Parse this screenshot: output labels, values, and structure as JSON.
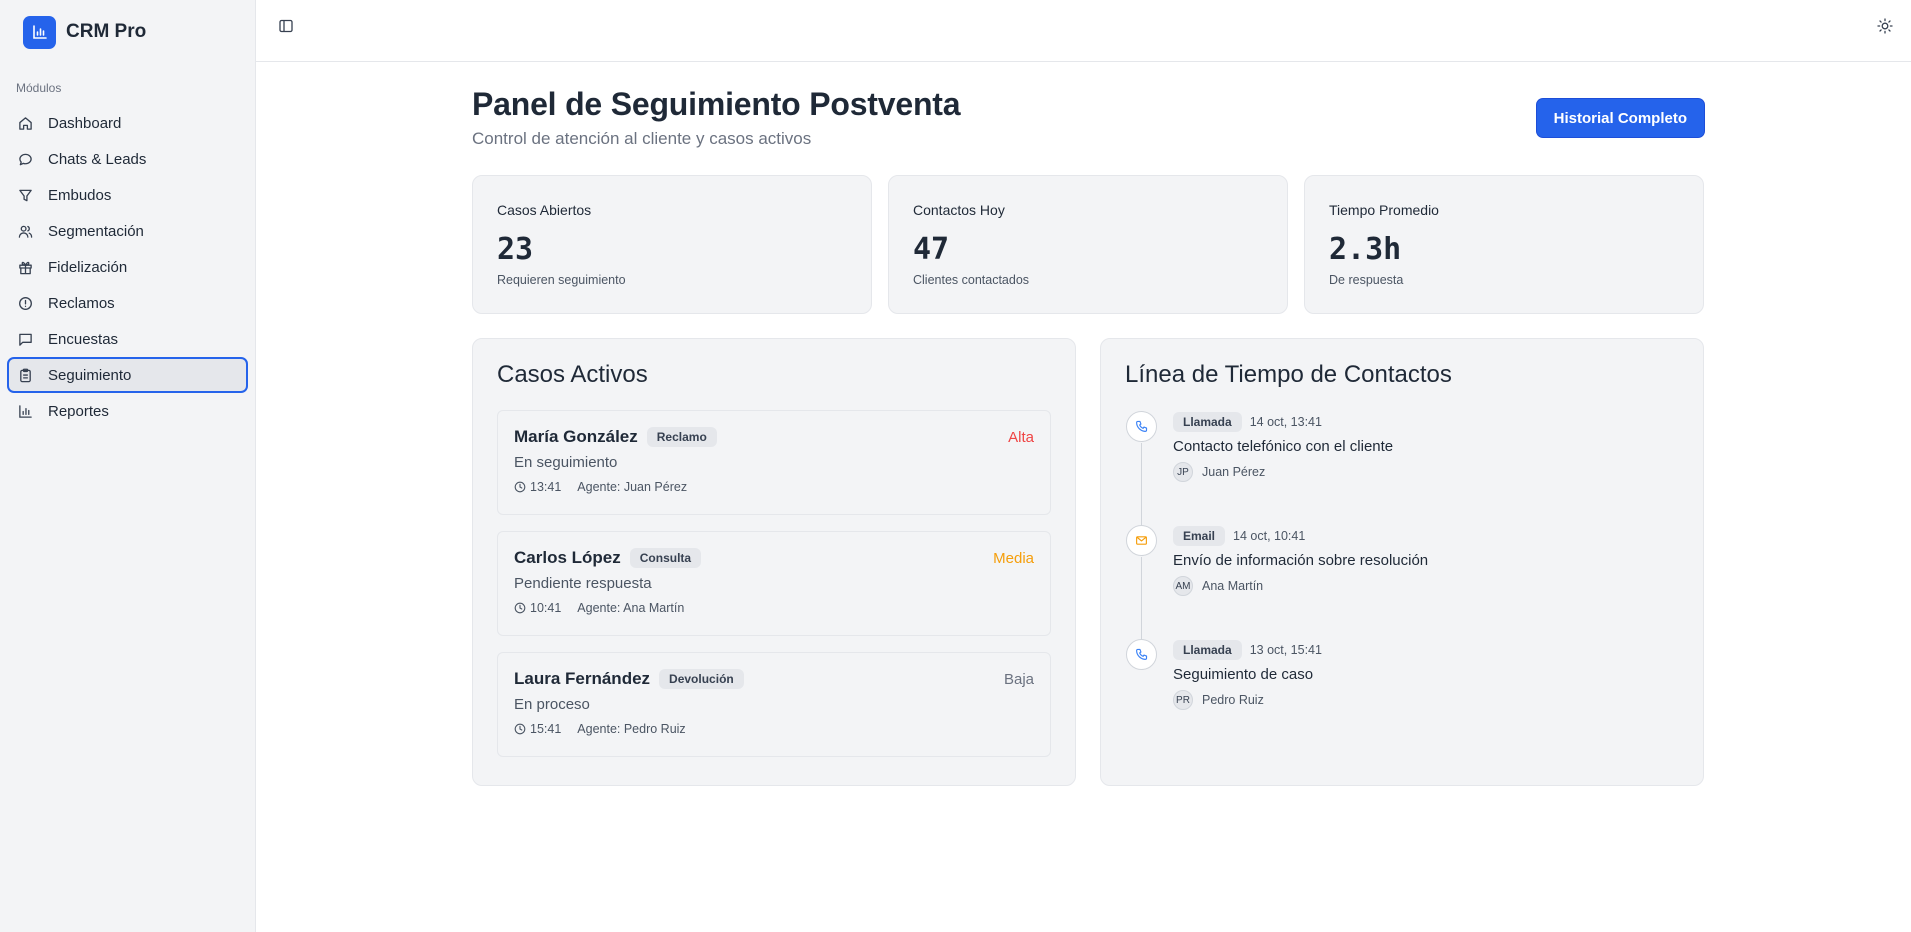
{
  "app": {
    "name": "CRM Pro"
  },
  "sidebar": {
    "section_label": "Módulos",
    "items": [
      {
        "label": "Dashboard",
        "icon": "home-icon"
      },
      {
        "label": "Chats & Leads",
        "icon": "chat-icon"
      },
      {
        "label": "Embudos",
        "icon": "funnel-icon"
      },
      {
        "label": "Segmentación",
        "icon": "users-icon"
      },
      {
        "label": "Fidelización",
        "icon": "gift-icon"
      },
      {
        "label": "Reclamos",
        "icon": "alert-circle-icon"
      },
      {
        "label": "Encuestas",
        "icon": "message-square-icon"
      },
      {
        "label": "Seguimiento",
        "icon": "clipboard-icon",
        "active": true
      },
      {
        "label": "Reportes",
        "icon": "bar-chart-icon"
      }
    ]
  },
  "header": {
    "title": "Panel de Seguimiento Postventa",
    "subtitle": "Control de atención al cliente y casos activos",
    "history_button": "Historial Completo"
  },
  "stats": [
    {
      "title": "Casos Abiertos",
      "value": "23",
      "sub": "Requieren seguimiento"
    },
    {
      "title": "Contactos Hoy",
      "value": "47",
      "sub": "Clientes contactados"
    },
    {
      "title": "Tiempo Promedio",
      "value": "2.3h",
      "sub": "De respuesta"
    }
  ],
  "cases": {
    "title": "Casos Activos",
    "items": [
      {
        "name": "María González",
        "type": "Reclamo",
        "priority": "Alta",
        "priority_color": "#ef4444",
        "status": "En seguimiento",
        "time": "13:41",
        "agent": "Agente: Juan Pérez"
      },
      {
        "name": "Carlos López",
        "type": "Consulta",
        "priority": "Media",
        "priority_color": "#f59e0b",
        "status": "Pendiente respuesta",
        "time": "10:41",
        "agent": "Agente: Ana Martín"
      },
      {
        "name": "Laura Fernández",
        "type": "Devolución",
        "priority": "Baja",
        "priority_color": "#6b7280",
        "status": "En proceso",
        "time": "15:41",
        "agent": "Agente: Pedro Ruiz"
      }
    ]
  },
  "timeline": {
    "title": "Línea de Tiempo de Contactos",
    "items": [
      {
        "type": "Llamada",
        "icon": "phone-icon",
        "icon_color": "#3b82f6",
        "time": "14 oct, 13:41",
        "description": "Contacto telefónico con el cliente",
        "initials": "JP",
        "agent": "Juan Pérez"
      },
      {
        "type": "Email",
        "icon": "mail-icon",
        "icon_color": "#f59e0b",
        "time": "14 oct, 10:41",
        "description": "Envío de información sobre resolución",
        "initials": "AM",
        "agent": "Ana Martín"
      },
      {
        "type": "Llamada",
        "icon": "phone-icon",
        "icon_color": "#3b82f6",
        "time": "13 oct, 15:41",
        "description": "Seguimiento de caso",
        "initials": "PR",
        "agent": "Pedro Ruiz"
      }
    ]
  },
  "colors": {
    "accent": "#2563eb"
  }
}
